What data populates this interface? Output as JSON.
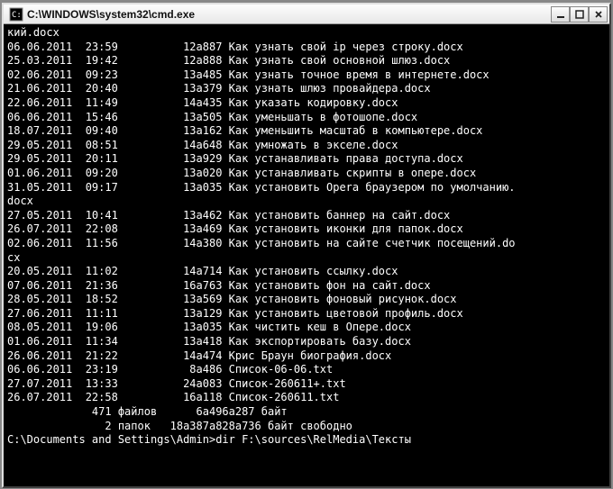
{
  "window": {
    "title": "C:\\WINDOWS\\system32\\cmd.exe"
  },
  "listing": {
    "partial_top": "кий.docx",
    "rows": [
      {
        "date": "06.06.2011",
        "time": "23:59",
        "size": "12а887",
        "name": "Как узнать свой ip через строку.docx"
      },
      {
        "date": "25.03.2011",
        "time": "19:42",
        "size": "12а888",
        "name": "Как узнать свой основной шлюз.docx"
      },
      {
        "date": "02.06.2011",
        "time": "09:23",
        "size": "13а485",
        "name": "Как узнать точное время в интернете.docx"
      },
      {
        "date": "21.06.2011",
        "time": "20:40",
        "size": "13а379",
        "name": "Как узнать шлюз провайдера.docx"
      },
      {
        "date": "22.06.2011",
        "time": "11:49",
        "size": "14а435",
        "name": "Как указать кодировку.docx"
      },
      {
        "date": "06.06.2011",
        "time": "15:46",
        "size": "13а505",
        "name": "Как уменьшать в фотошопе.docx"
      },
      {
        "date": "18.07.2011",
        "time": "09:40",
        "size": "13а162",
        "name": "Как уменьшить масштаб в компьютере.docx"
      },
      {
        "date": "29.05.2011",
        "time": "08:51",
        "size": "14а648",
        "name": "Как умножать в экселе.docx"
      },
      {
        "date": "29.05.2011",
        "time": "20:11",
        "size": "13а929",
        "name": "Как устанавливать права доступа.docx"
      },
      {
        "date": "01.06.2011",
        "time": "09:20",
        "size": "13а020",
        "name": "Как устанавливать скрипты в опере.docx"
      },
      {
        "date": "31.05.2011",
        "time": "09:17",
        "size": "13а035",
        "name": "Как установить Opera браузером по умолчанию."
      },
      {
        "wrap": "docx"
      },
      {
        "date": "27.05.2011",
        "time": "10:41",
        "size": "13а462",
        "name": "Как установить баннер на сайт.docx"
      },
      {
        "date": "26.07.2011",
        "time": "22:08",
        "size": "13а469",
        "name": "Как установить иконки для папок.docx"
      },
      {
        "date": "02.06.2011",
        "time": "11:56",
        "size": "14а380",
        "name": "Как установить на сайте счетчик посещений.do"
      },
      {
        "wrap": "cx"
      },
      {
        "date": "20.05.2011",
        "time": "11:02",
        "size": "14а714",
        "name": "Как установить ссылку.docx"
      },
      {
        "date": "07.06.2011",
        "time": "21:36",
        "size": "16а763",
        "name": "Как установить фон на сайт.docx"
      },
      {
        "date": "28.05.2011",
        "time": "18:52",
        "size": "13а569",
        "name": "Как установить фоновый рисунок.docx"
      },
      {
        "date": "27.06.2011",
        "time": "11:11",
        "size": "13а129",
        "name": "Как установить цветовой профиль.docx"
      },
      {
        "date": "08.05.2011",
        "time": "19:06",
        "size": "13а035",
        "name": "Как чистить кеш в Опере.docx"
      },
      {
        "date": "01.06.2011",
        "time": "11:34",
        "size": "13а418",
        "name": "Как экспортировать базу.docx"
      },
      {
        "date": "26.06.2011",
        "time": "21:22",
        "size": "14а474",
        "name": "Крис Браун биография.docx"
      },
      {
        "date": "06.06.2011",
        "time": "23:19",
        "size": "8а486",
        "name": "Список-06-06.txt"
      },
      {
        "date": "27.07.2011",
        "time": "13:33",
        "size": "24а083",
        "name": "Список-260611+.txt"
      },
      {
        "date": "26.07.2011",
        "time": "22:58",
        "size": "16а118",
        "name": "Список-260611.txt"
      }
    ],
    "summary_files": "             471 файлов      6а496а287 байт",
    "summary_dirs": "               2 папок   18а387а828а736 байт свободно"
  },
  "prompt": {
    "path": "C:\\Documents and Settings\\Admin>",
    "command": "dir F:\\sources\\RelMedia\\Тексты"
  }
}
